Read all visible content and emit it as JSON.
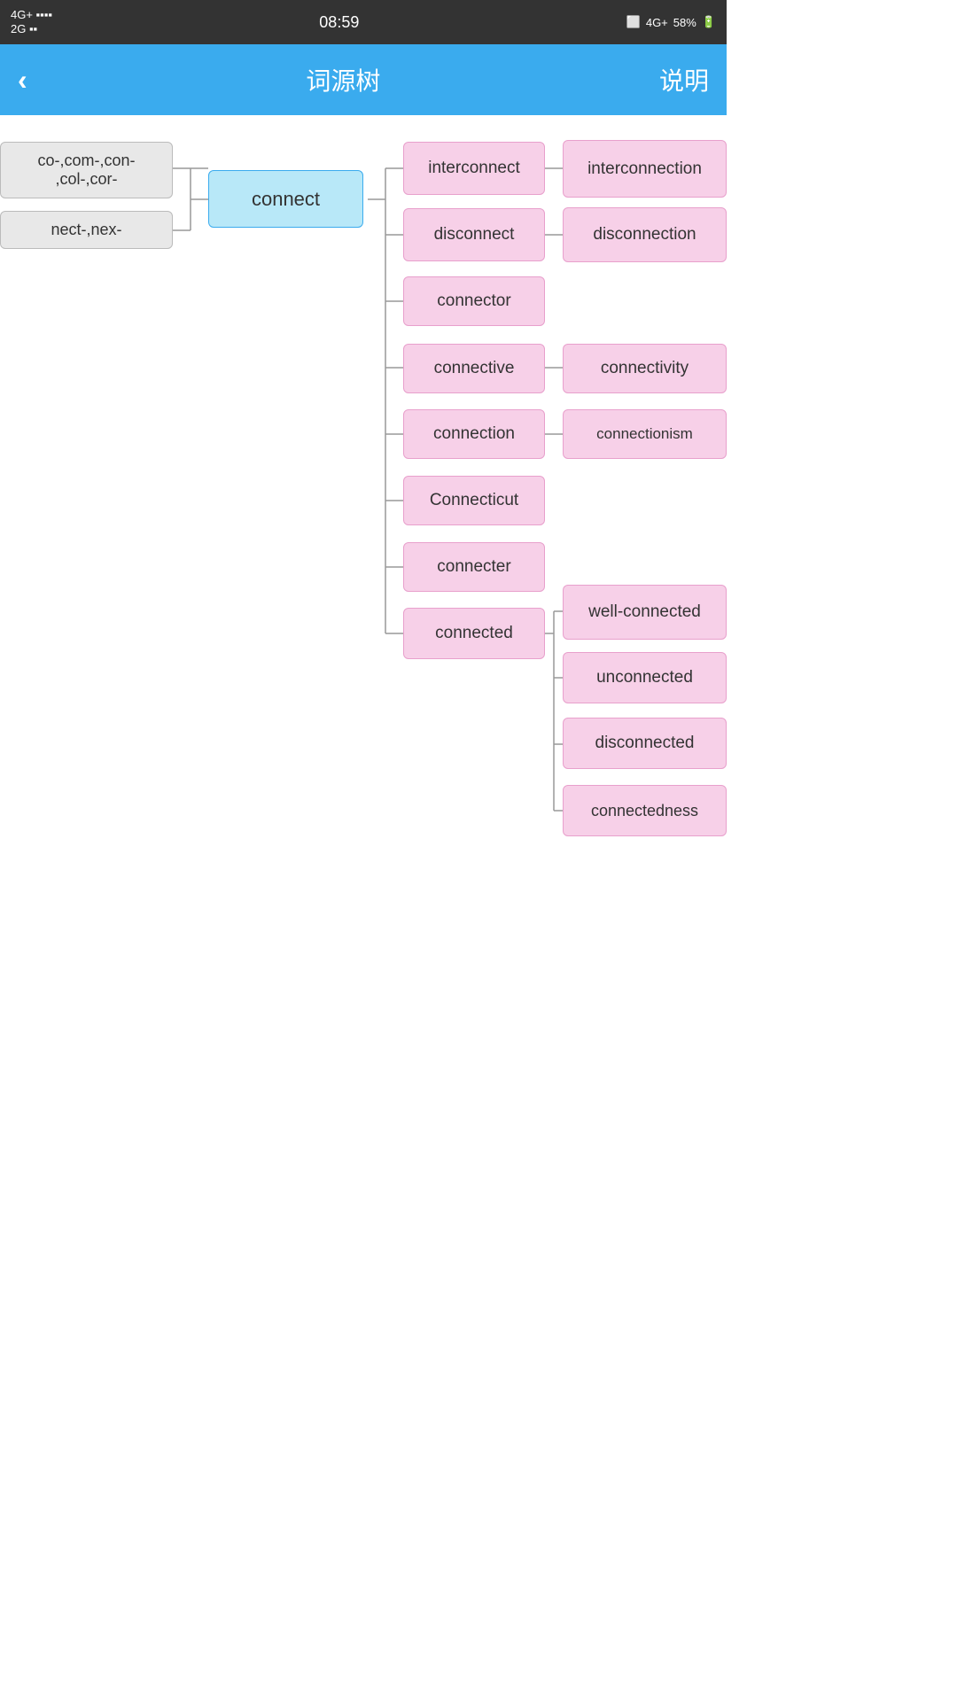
{
  "status": {
    "left_top": "4G+",
    "left_signal": "2G",
    "time": "08:59",
    "right_network": "4G+",
    "right_battery": "58%"
  },
  "nav": {
    "back_icon": "‹",
    "title": "词源树",
    "action": "说明"
  },
  "tree": {
    "prefix1": "co-,com-,con-\n,col-,cor-",
    "prefix2": "nect-,nex-",
    "root": "connect",
    "level1": [
      {
        "id": "interconnect",
        "label": "interconnect"
      },
      {
        "id": "disconnect",
        "label": "disconnect"
      },
      {
        "id": "connector",
        "label": "connector"
      },
      {
        "id": "connective",
        "label": "connective"
      },
      {
        "id": "connection",
        "label": "connection"
      },
      {
        "id": "Connecticut",
        "label": "Connecticut"
      },
      {
        "id": "connecter",
        "label": "connecter"
      },
      {
        "id": "connected",
        "label": "connected"
      }
    ],
    "level2": [
      {
        "id": "interconnection",
        "label": "interconnection",
        "parent": "interconnect"
      },
      {
        "id": "disconnection",
        "label": "disconnection",
        "parent": "disconnect"
      },
      {
        "id": "connectivity",
        "label": "connectivity",
        "parent": "connective"
      },
      {
        "id": "connectionism",
        "label": "connectionism",
        "parent": "connection"
      },
      {
        "id": "well-connected",
        "label": "well-connected",
        "parent": "connected"
      },
      {
        "id": "unconnected",
        "label": "unconnected",
        "parent": "connected"
      },
      {
        "id": "disconnected",
        "label": "disconnected",
        "parent": "connected"
      },
      {
        "id": "connectedness",
        "label": "connectedness",
        "parent": "connected"
      }
    ]
  }
}
